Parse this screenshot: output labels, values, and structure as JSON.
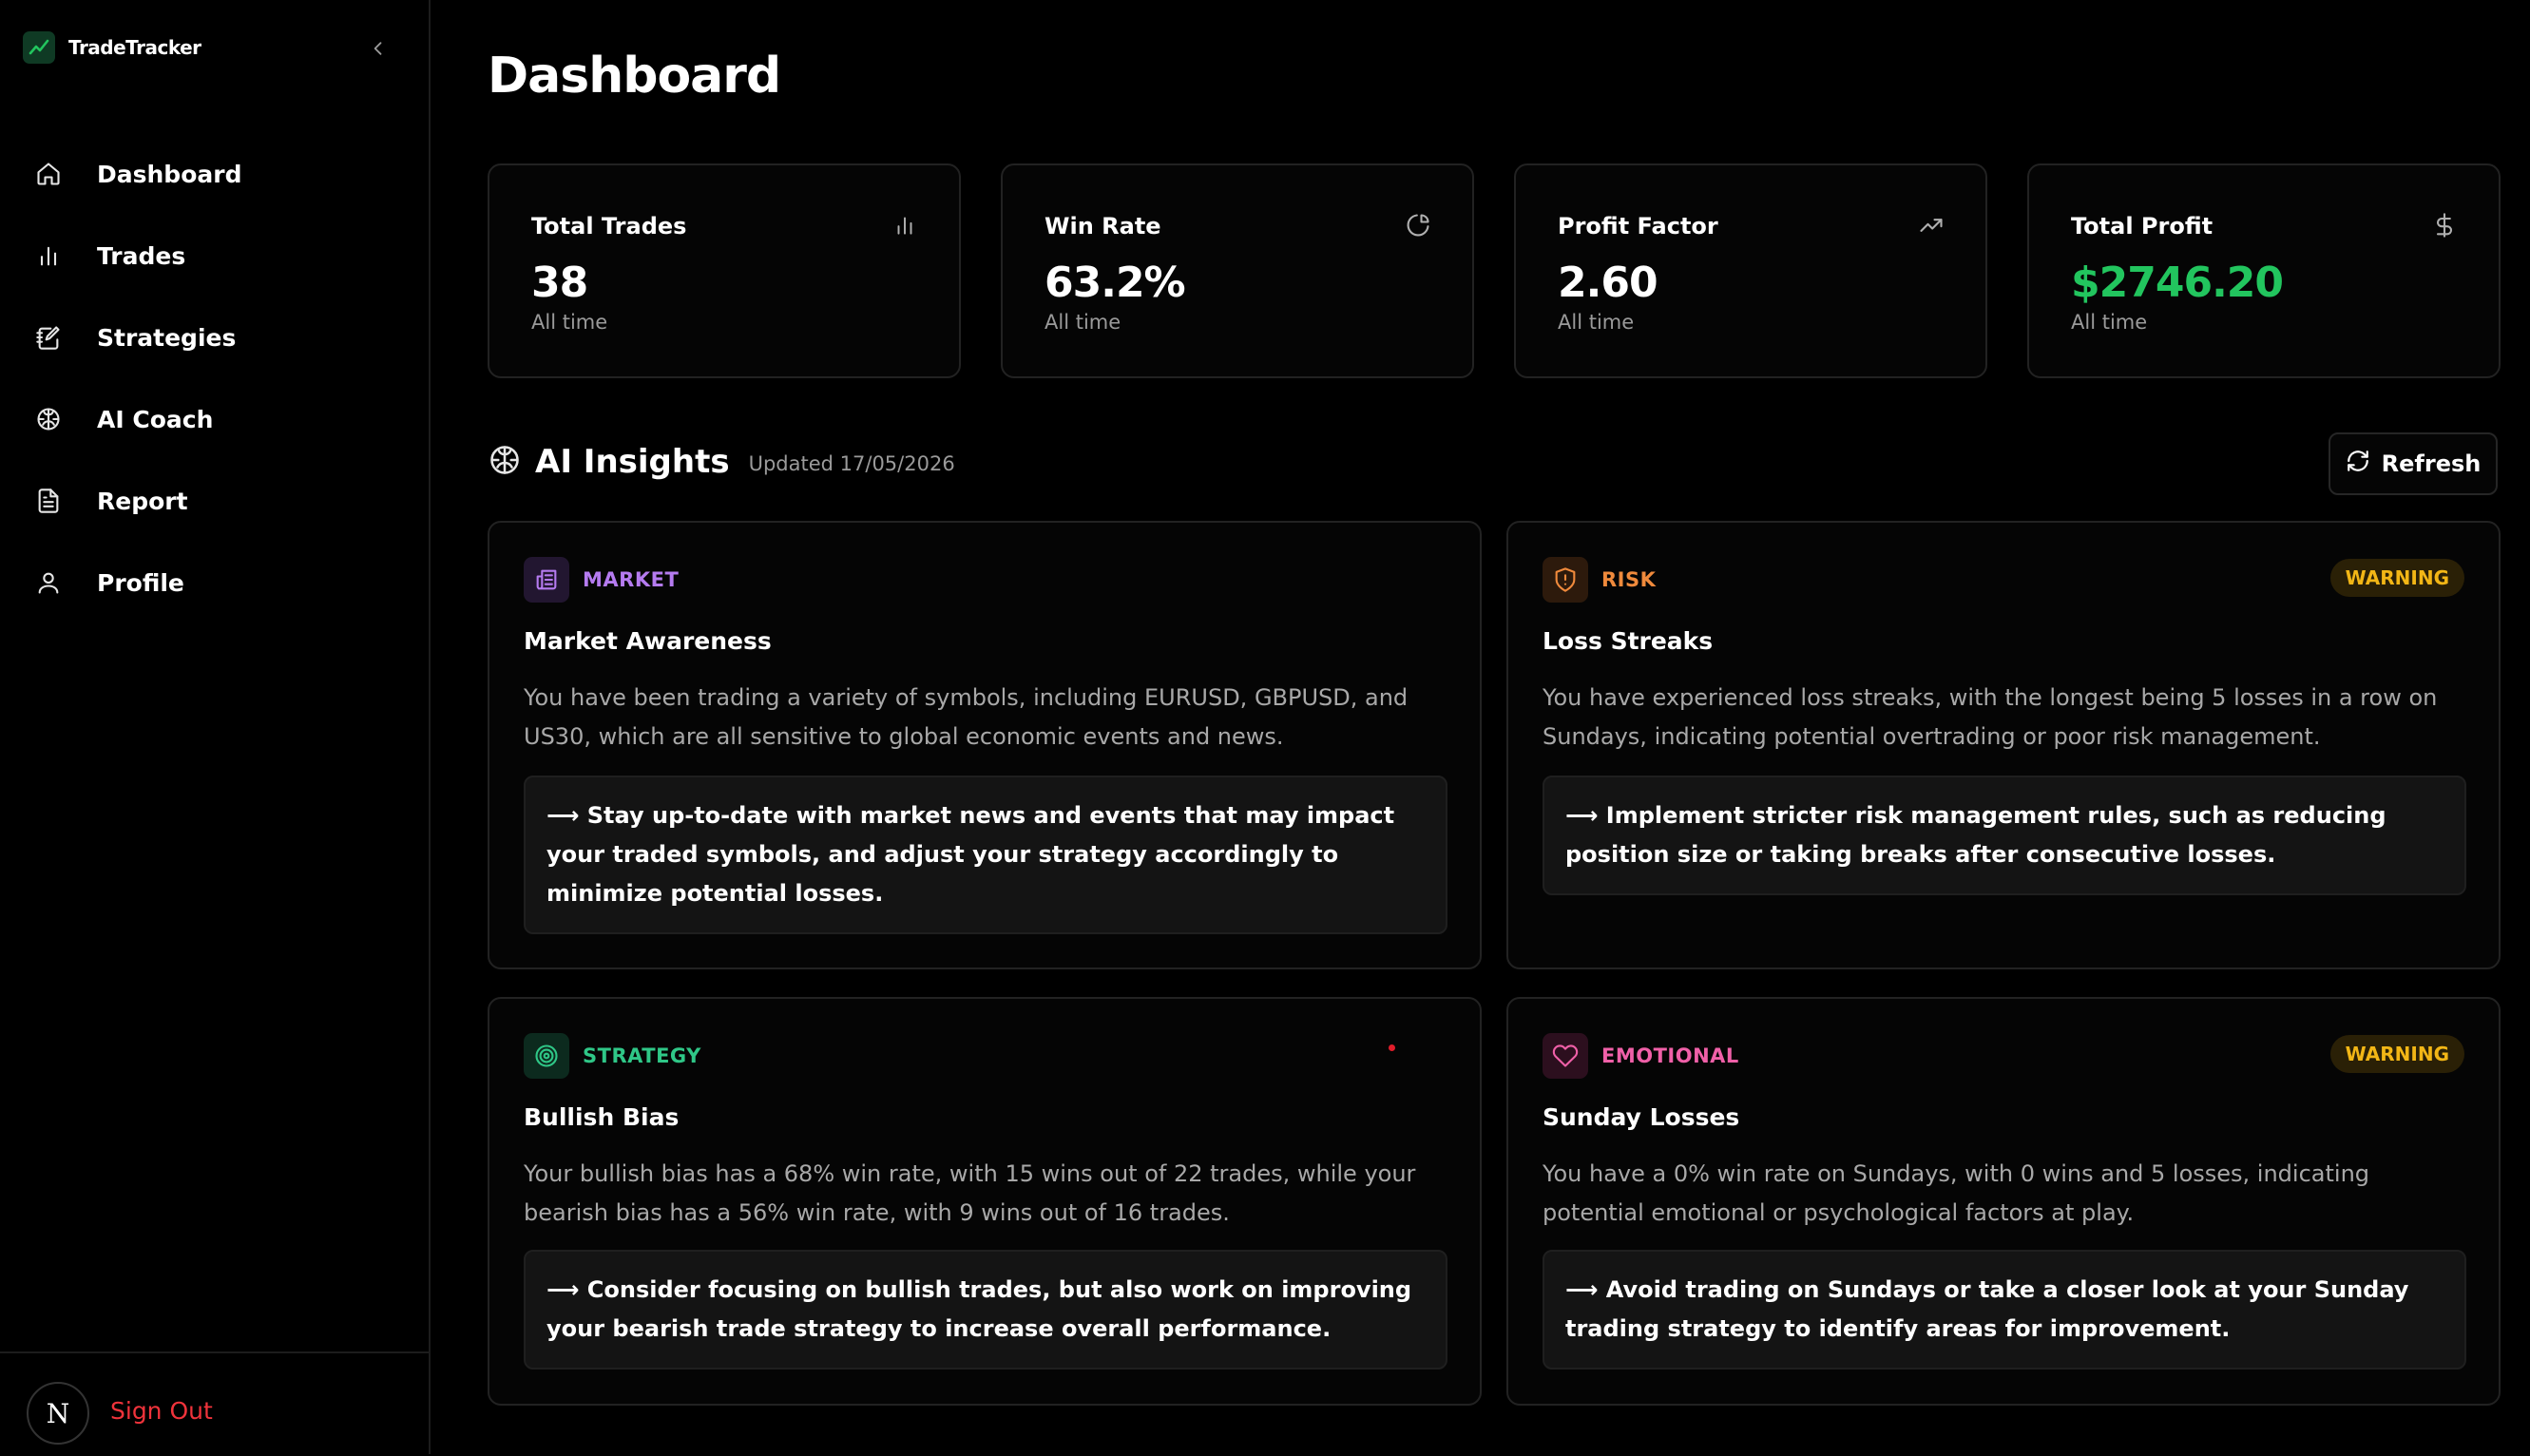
{
  "app": {
    "name": "TradeTracker",
    "accent": "#22c55e",
    "danger": "#f0333b"
  },
  "sidebar": {
    "items": [
      {
        "label": "Dashboard",
        "icon": "home-icon"
      },
      {
        "label": "Trades",
        "icon": "bar-chart-icon"
      },
      {
        "label": "Strategies",
        "icon": "notebook-pen-icon"
      },
      {
        "label": "AI Coach",
        "icon": "brain-icon"
      },
      {
        "label": "Report",
        "icon": "file-text-icon"
      },
      {
        "label": "Profile",
        "icon": "user-icon"
      }
    ],
    "avatar_letter": "N",
    "sign_out": "Sign Out"
  },
  "page": {
    "title": "Dashboard"
  },
  "stats": [
    {
      "label": "Total Trades",
      "value": "38",
      "sub": "All time",
      "icon": "bar-chart-icon"
    },
    {
      "label": "Win Rate",
      "value": "63.2%",
      "sub": "All time",
      "icon": "pie-chart-icon"
    },
    {
      "label": "Profit Factor",
      "value": "2.60",
      "sub": "All time",
      "icon": "trending-up-icon"
    },
    {
      "label": "Total Profit",
      "value": "$2746.20",
      "sub": "All time",
      "icon": "dollar-sign-icon",
      "value_color": "#22c55e"
    }
  ],
  "insights": {
    "title": "AI Insights",
    "updated": "Updated 17/05/2026",
    "refresh_label": "Refresh",
    "cards": [
      {
        "category": "MARKET",
        "category_color": "#b57bf0",
        "icon": "newspaper-icon",
        "title": "Market Awareness",
        "description": "You have been trading a variety of symbols, including EURUSD, GBPUSD, and US30, which are all sensitive to global economic events and news.",
        "action": "⟶ Stay up-to-date with market news and events that may impact your traded symbols, and adjust your strategy accordingly to minimize potential losses."
      },
      {
        "category": "RISK",
        "category_color": "#f08a3c",
        "icon": "shield-alert-icon",
        "badge": "WARNING",
        "title": "Loss Streaks",
        "description": "You have experienced loss streaks, with the longest being 5 losses in a row on Sundays, indicating potential overtrading or poor risk management.",
        "action": "⟶ Implement stricter risk management rules, such as reducing position size or taking breaks after consecutive losses."
      },
      {
        "category": "STRATEGY",
        "category_color": "#2fc787",
        "icon": "target-icon",
        "title": "Bullish Bias",
        "description": "Your bullish bias has a 68% win rate, with 15 wins out of 22 trades, while your bearish bias has a 56% win rate, with 9 wins out of 16 trades.",
        "action": "⟶ Consider focusing on bullish trades, but also work on improving your bearish trade strategy to increase overall performance."
      },
      {
        "category": "EMOTIONAL",
        "category_color": "#f060a8",
        "icon": "heart-icon",
        "badge": "WARNING",
        "title": "Sunday Losses",
        "description": "You have a 0% win rate on Sundays, with 0 wins and 5 losses, indicating potential emotional or psychological factors at play.",
        "action": "⟶ Avoid trading on Sundays or take a closer look at your Sunday trading strategy to identify areas for improvement."
      }
    ]
  }
}
